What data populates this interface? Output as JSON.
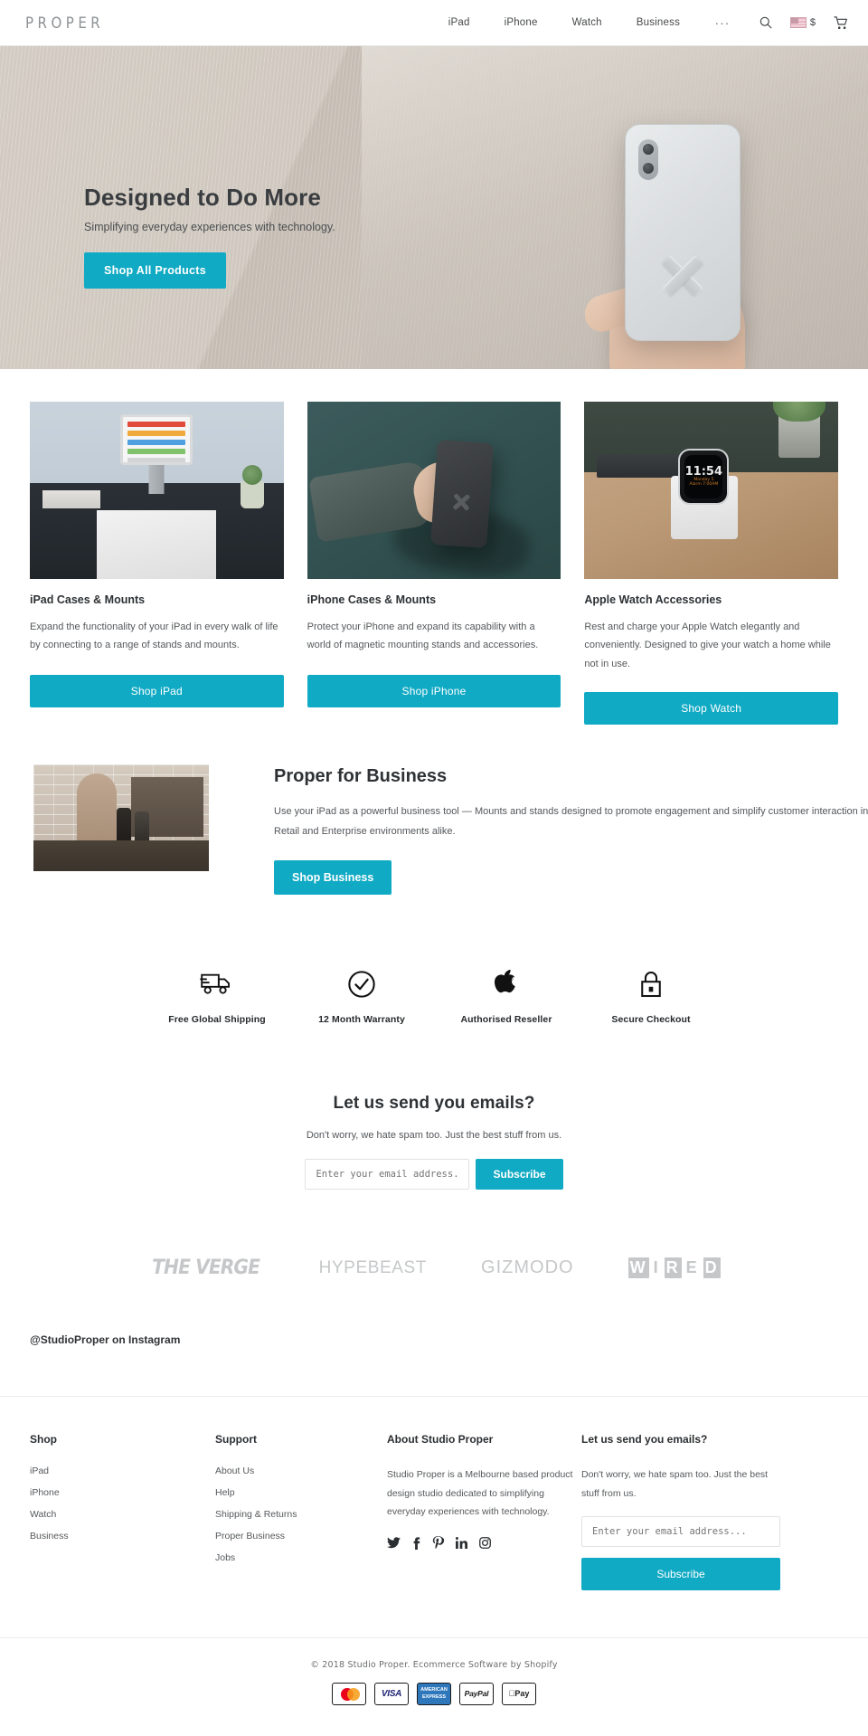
{
  "header": {
    "logo": "PROPER",
    "nav": [
      {
        "label": "iPad"
      },
      {
        "label": "iPhone"
      },
      {
        "label": "Watch"
      },
      {
        "label": "Business"
      }
    ],
    "more": "...",
    "search_icon": "search-icon",
    "currency": "$",
    "flag": "us-flag-icon",
    "cart_icon": "shopping-cart-icon"
  },
  "hero": {
    "title": "Designed to Do More",
    "subtitle": "Simplifying everyday experiences with technology.",
    "cta": "Shop All Products"
  },
  "cards": [
    {
      "title": "iPad Cases & Mounts",
      "desc": "Expand the functionality of your iPad in every walk of life by connecting to a range of stands and mounts.",
      "button": "Shop iPad"
    },
    {
      "title": "iPhone Cases & Mounts",
      "desc": "Protect your iPhone and expand its capability with a world of magnetic mounting stands and accessories.",
      "button": "Shop iPhone"
    },
    {
      "title": "Apple Watch Accessories",
      "desc": "Rest and charge your Apple Watch elegantly and conveniently. Designed to give your watch a home while not in use.",
      "button": "Shop Watch"
    }
  ],
  "watch_face": {
    "time": "11:54",
    "day": "Monday 5",
    "alarm": "Alarm 7:00AM"
  },
  "business": {
    "title": "Proper for Business",
    "desc": "Use your iPad as a powerful business tool — Mounts and stands designed to promote engagement and simplify customer interaction in Retail and Enterprise environments alike.",
    "cta": "Shop Business"
  },
  "badges": [
    {
      "icon": "truck-icon",
      "label": "Free Global Shipping"
    },
    {
      "icon": "check-circle-icon",
      "label": "12 Month Warranty"
    },
    {
      "icon": "apple-icon",
      "label": "Authorised Reseller"
    },
    {
      "icon": "lock-icon",
      "label": "Secure Checkout"
    }
  ],
  "newsletter": {
    "title": "Let us send you emails?",
    "subtitle": "Don't worry, we hate spam too. Just the best stuff from us.",
    "placeholder": "Enter your email address...",
    "button": "Subscribe"
  },
  "press": [
    {
      "name": "THE VERGE"
    },
    {
      "name": "HYPEBEAST"
    },
    {
      "name": "GIZMODO"
    },
    {
      "name": "WIRED"
    }
  ],
  "instagram": "@StudioProper on Instagram",
  "footer": {
    "shop": {
      "title": "Shop",
      "links": [
        "iPad",
        "iPhone",
        "Watch",
        "Business"
      ]
    },
    "support": {
      "title": "Support",
      "links": [
        "About Us",
        "Help",
        "Shipping & Returns",
        "Proper Business",
        "Jobs"
      ]
    },
    "about": {
      "title": "About Studio Proper",
      "text": "Studio Proper is a Melbourne based product design studio dedicated to simplifying everyday experiences with technology.",
      "social": [
        "twitter-icon",
        "facebook-icon",
        "pinterest-icon",
        "linkedin-icon",
        "instagram-icon"
      ]
    },
    "subscribe": {
      "title": "Let us send you emails?",
      "text": "Don't worry, we hate spam too. Just the best stuff from us.",
      "placeholder": "Enter your email address...",
      "button": "Subscribe"
    }
  },
  "copyright": {
    "text": "© 2018 Studio Proper. Ecommerce Software by Shopify",
    "payments": [
      "Mastercard",
      "VISA",
      "AMERICAN EXPRESS",
      "PayPal",
      "Apple Pay"
    ]
  },
  "colors": {
    "accent": "#11aac4",
    "text": "#2f3235",
    "muted": "#55585b"
  }
}
